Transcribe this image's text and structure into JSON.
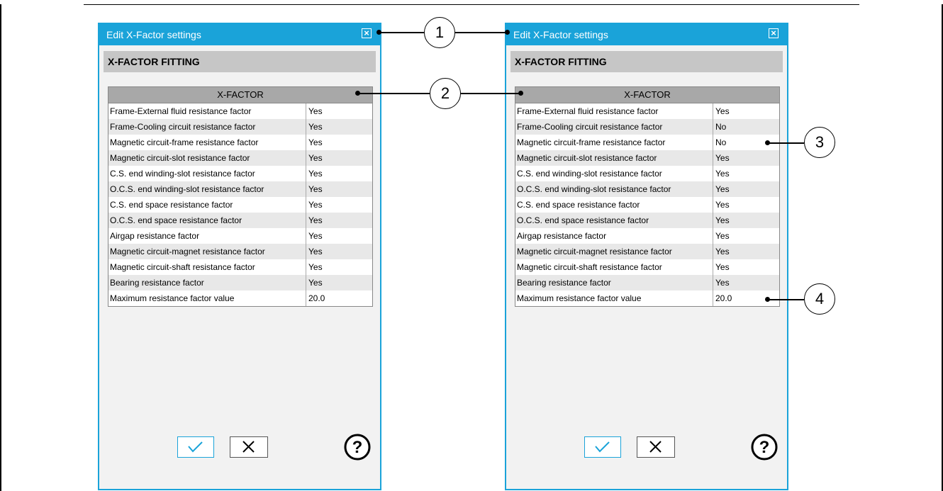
{
  "dialogs": [
    {
      "title": "Edit X-Factor settings",
      "section": "X-FACTOR FITTING",
      "table_header": "X-FACTOR",
      "rows": [
        {
          "label": "Frame-External fluid resistance factor",
          "value": "Yes"
        },
        {
          "label": "Frame-Cooling circuit resistance factor",
          "value": "Yes"
        },
        {
          "label": "Magnetic circuit-frame resistance factor",
          "value": "Yes"
        },
        {
          "label": "Magnetic circuit-slot resistance factor",
          "value": "Yes"
        },
        {
          "label": "C.S. end winding-slot resistance factor",
          "value": "Yes"
        },
        {
          "label": "O.C.S. end winding-slot resistance factor",
          "value": "Yes"
        },
        {
          "label": "C.S. end space resistance factor",
          "value": "Yes"
        },
        {
          "label": "O.C.S. end space resistance factor",
          "value": "Yes"
        },
        {
          "label": "Airgap resistance factor",
          "value": "Yes"
        },
        {
          "label": "Magnetic circuit-magnet resistance factor",
          "value": "Yes"
        },
        {
          "label": "Magnetic circuit-shaft resistance factor",
          "value": "Yes"
        },
        {
          "label": "Bearing resistance factor",
          "value": "Yes"
        },
        {
          "label": "Maximum resistance factor value",
          "value": "20.0"
        }
      ]
    },
    {
      "title": "Edit X-Factor settings",
      "section": "X-FACTOR FITTING",
      "table_header": "X-FACTOR",
      "rows": [
        {
          "label": "Frame-External fluid resistance factor",
          "value": "Yes"
        },
        {
          "label": "Frame-Cooling circuit resistance factor",
          "value": "No"
        },
        {
          "label": "Magnetic circuit-frame resistance factor",
          "value": "No"
        },
        {
          "label": "Magnetic circuit-slot resistance factor",
          "value": "Yes"
        },
        {
          "label": "C.S. end winding-slot resistance factor",
          "value": "Yes"
        },
        {
          "label": "O.C.S. end winding-slot resistance factor",
          "value": "Yes"
        },
        {
          "label": "C.S. end space resistance factor",
          "value": "Yes"
        },
        {
          "label": "O.C.S. end space resistance factor",
          "value": "Yes"
        },
        {
          "label": "Airgap resistance factor",
          "value": "Yes"
        },
        {
          "label": "Magnetic circuit-magnet resistance factor",
          "value": "Yes"
        },
        {
          "label": "Magnetic circuit-shaft resistance factor",
          "value": "Yes"
        },
        {
          "label": "Bearing resistance factor",
          "value": "Yes"
        },
        {
          "label": "Maximum resistance factor value",
          "value": "20.0"
        }
      ]
    }
  ],
  "callouts": [
    "1",
    "2",
    "3",
    "4"
  ],
  "icons": {
    "close": "close-icon",
    "ok": "checkmark-icon",
    "cancel": "x-icon",
    "help": "question-icon"
  },
  "colors": {
    "accent": "#1aa3d9",
    "header_gray": "#c6c6c6",
    "table_head": "#a8a8a8"
  }
}
